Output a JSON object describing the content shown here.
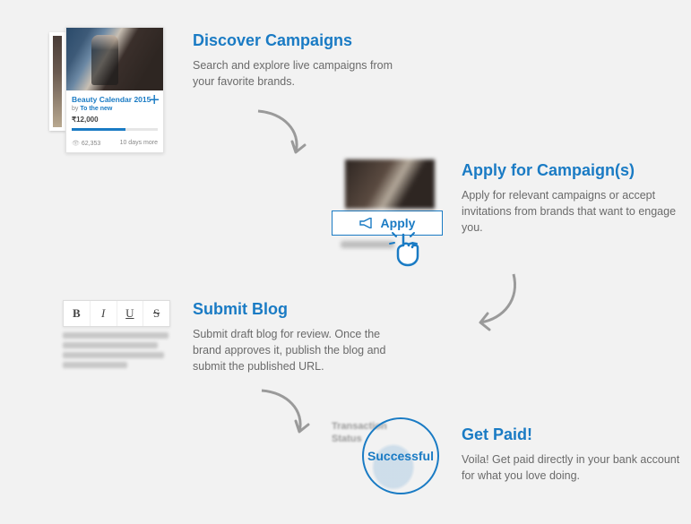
{
  "steps": [
    {
      "title": "Discover Campaigns",
      "desc": "Search and explore live campaigns from your favorite brands."
    },
    {
      "title": "Apply for Campaign(s)",
      "desc": "Apply for relevant campaigns or accept invitations from brands that want to engage you."
    },
    {
      "title": "Submit Blog",
      "desc": "Submit draft blog for review. Once the brand approves it, publish the blog and submit the published URL."
    },
    {
      "title": "Get Paid!",
      "desc": "Voila! Get paid directly in your bank account for what you love doing."
    }
  ],
  "card": {
    "name": "Beauty Calendar 2015",
    "by_prefix": "by ",
    "by_brand": "To the new",
    "price": "₹12,000",
    "views": "62,353",
    "days": "10 days more"
  },
  "apply_button": {
    "label": "Apply"
  },
  "editor": {
    "bold": "B",
    "italic": "I",
    "underline": "U",
    "strike": "S"
  },
  "paid": {
    "line1": "Transaction",
    "line2": "Status",
    "badge": "Successful"
  }
}
